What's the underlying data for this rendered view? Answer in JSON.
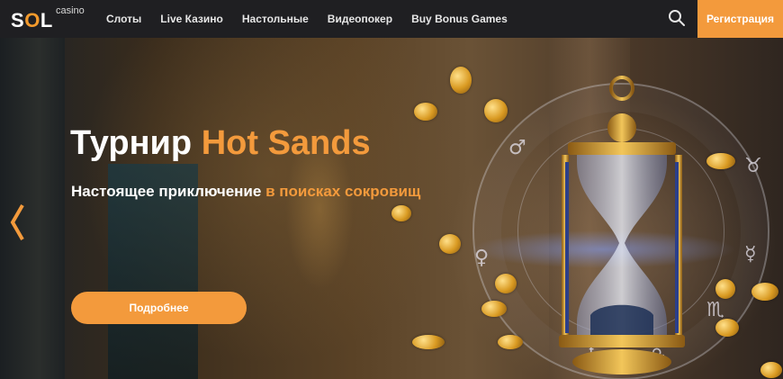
{
  "header": {
    "logo": {
      "brand": "SOL",
      "sub": "casino"
    },
    "nav": [
      "Слоты",
      "Live Казино",
      "Настольные",
      "Видеопокер",
      "Buy Bonus Games"
    ],
    "search_icon": "search-icon",
    "register_label": "Регистрация"
  },
  "hero": {
    "title_plain": "Турнир",
    "title_accent": "Hot Sands",
    "subtitle_plain": "Настоящее приключение",
    "subtitle_accent": "в поисках сокровищ",
    "cta_label": "Подробнее",
    "prev_icon": "chevron-left-icon"
  },
  "colors": {
    "accent": "#f39a3c",
    "header_bg": "#1f1f22",
    "text": "#ffffff"
  }
}
